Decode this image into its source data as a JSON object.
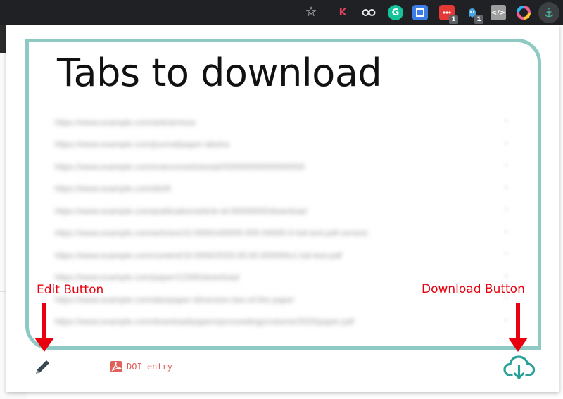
{
  "browser": {
    "extensions": [
      {
        "name": "k-extension",
        "glyph": "K"
      },
      {
        "name": "glasses-extension",
        "glyph": ""
      },
      {
        "name": "grammarly-extension",
        "glyph": "G"
      },
      {
        "name": "blue-extension",
        "glyph": ""
      },
      {
        "name": "red-extension",
        "glyph": "",
        "badge": "1"
      },
      {
        "name": "ghost-extension",
        "glyph": "",
        "badge": "1"
      },
      {
        "name": "code-extension",
        "glyph": "</>"
      },
      {
        "name": "ring-extension",
        "glyph": ""
      },
      {
        "name": "anchor-extension",
        "glyph": "⚓"
      }
    ]
  },
  "popup": {
    "title": "Tabs to download",
    "tabs": [
      "https://www.example.com/article/research-paper-one",
      "https://www.example.com/journal/paper-abstract-and-details",
      "https://www.example.com/science/articles/pii/S0000000000000000",
      "https://www.example.com/doi/full/10.0000",
      "https://www.example.com/publication/article-id-00000000/download",
      "https://www.example.com/articles/10.0000/s00000-000-00000-0-full-text-pdf-version",
      "https://www.example.com/content/10.0000/2020.00.00.000000v1.full-text-pdf",
      "https://www.example.com/paper/12345/download",
      "https://www.example.com/abs/paper-id/version-two-of-the-paper",
      "https://www.example.com/download/papers/proceedings/volume/2020/paper.pdf"
    ],
    "doi_entry": "DOI entry"
  },
  "annotations": {
    "edit": "Edit Button",
    "download": "Download Button"
  },
  "colors": {
    "frame": "#8fc9c3",
    "accent": "#2aa198",
    "annotation": "#e8000f",
    "pdf": "#e0605a"
  }
}
